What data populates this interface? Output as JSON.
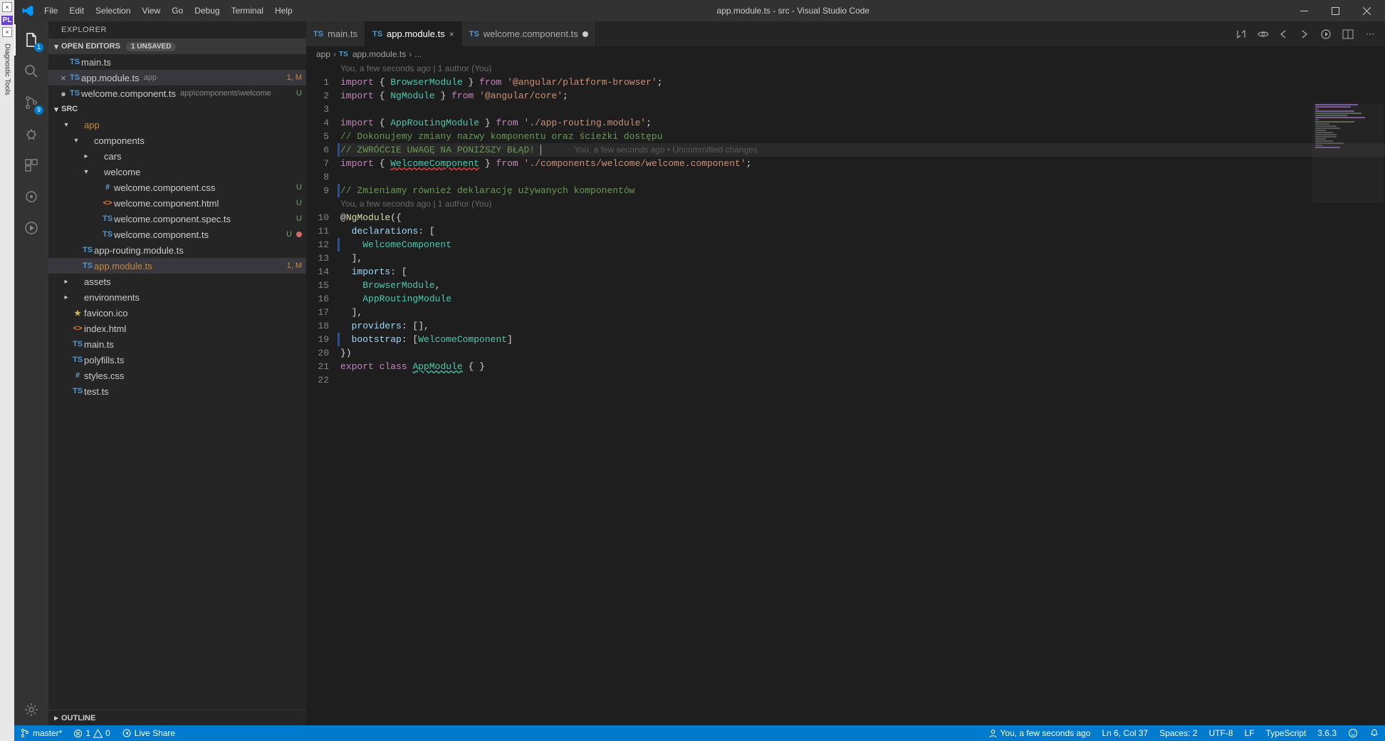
{
  "window_title": "app.module.ts - src - Visual Studio Code",
  "menu": [
    "File",
    "Edit",
    "Selection",
    "View",
    "Go",
    "Debug",
    "Terminal",
    "Help"
  ],
  "activity_badges": {
    "explorer": "1",
    "scm": "9"
  },
  "sidebar": {
    "title": "EXPLORER",
    "open_editors_label": "OPEN EDITORS",
    "unsaved_label": "1 UNSAVED",
    "open_editors": [
      {
        "name": "main.ts",
        "ico": "TS",
        "pre": " "
      },
      {
        "name": "app.module.ts",
        "ico": "TS",
        "pre": "×",
        "hint": "app",
        "status": "1, M",
        "status_cls": "m",
        "active": true
      },
      {
        "name": "welcome.component.ts",
        "ico": "TS",
        "pre": "●",
        "hint": "app\\components\\welcome",
        "status": "U",
        "status_cls": "u"
      }
    ],
    "project_label": "SRC",
    "outline_label": "OUTLINE",
    "tree": [
      {
        "depth": 0,
        "chev": "▾",
        "ico": "",
        "name": "app",
        "color": "#c58b3b"
      },
      {
        "depth": 1,
        "chev": "▾",
        "ico": "",
        "name": "components"
      },
      {
        "depth": 2,
        "chev": "▸",
        "ico": "",
        "name": "cars"
      },
      {
        "depth": 2,
        "chev": "▾",
        "ico": "",
        "name": "welcome"
      },
      {
        "depth": 3,
        "ico": "#",
        "ico_cls": "css-ico",
        "name": "welcome.component.css",
        "status": "U",
        "status_cls": "u"
      },
      {
        "depth": 3,
        "ico": "<>",
        "ico_cls": "html-ico",
        "name": "welcome.component.html",
        "status": "U",
        "status_cls": "u"
      },
      {
        "depth": 3,
        "ico": "TS",
        "ico_cls": "ts-ico",
        "name": "welcome.component.spec.ts",
        "status": "U",
        "status_cls": "u"
      },
      {
        "depth": 3,
        "ico": "TS",
        "ico_cls": "ts-ico",
        "name": "welcome.component.ts",
        "status": "U",
        "status_cls": "u",
        "dot": "err"
      },
      {
        "depth": 1,
        "ico": "TS",
        "ico_cls": "ts-ico",
        "name": "app-routing.module.ts"
      },
      {
        "depth": 1,
        "ico": "TS",
        "ico_cls": "ts-ico",
        "name": "app.module.ts",
        "status": "1, M",
        "status_cls": "m",
        "active": true,
        "color": "#c58b3b"
      },
      {
        "depth": 0,
        "chev": "▸",
        "ico": "",
        "name": "assets"
      },
      {
        "depth": 0,
        "chev": "▸",
        "ico": "",
        "name": "environments"
      },
      {
        "depth": 0,
        "ico": "★",
        "ico_cls": "ico-fav",
        "name": "favicon.ico"
      },
      {
        "depth": 0,
        "ico": "<>",
        "ico_cls": "html-ico",
        "name": "index.html"
      },
      {
        "depth": 0,
        "ico": "TS",
        "ico_cls": "ts-ico",
        "name": "main.ts"
      },
      {
        "depth": 0,
        "ico": "TS",
        "ico_cls": "ts-ico",
        "name": "polyfills.ts"
      },
      {
        "depth": 0,
        "ico": "#",
        "ico_cls": "css-ico",
        "name": "styles.css"
      },
      {
        "depth": 0,
        "ico": "TS",
        "ico_cls": "ts-ico",
        "name": "test.ts"
      }
    ]
  },
  "tabs": [
    {
      "name": "main.ts",
      "ico": "TS"
    },
    {
      "name": "app.module.ts",
      "ico": "TS",
      "active": true,
      "closable": true
    },
    {
      "name": "welcome.component.ts",
      "ico": "TS",
      "dirty": true
    }
  ],
  "breadcrumb": {
    "folder": "app",
    "file": "app.module.ts",
    "more": "..."
  },
  "codelens": "You, a few seconds ago | 1 author (You)",
  "code_lines": [
    {
      "n": 1,
      "html": "<span class='kw'>import</span> <span class='br'>{</span> <span class='cls'>BrowserModule</span> <span class='br'>}</span> <span class='from'>from</span> <span class='str'>'@angular/platform-browser'</span><span class='white'>;</span>"
    },
    {
      "n": 2,
      "html": "<span class='kw'>import</span> <span class='br'>{</span> <span class='cls'>NgModule</span> <span class='br'>}</span> <span class='from'>from</span> <span class='str'>'@angular/core'</span><span class='white'>;</span>"
    },
    {
      "n": 3,
      "html": ""
    },
    {
      "n": 4,
      "html": "<span class='kw'>import</span> <span class='br'>{</span> <span class='cls'>AppRoutingModule</span> <span class='br'>}</span> <span class='from'>from</span> <span class='str'>'./app-routing.module'</span><span class='white'>;</span>"
    },
    {
      "n": 5,
      "html": "<span class='cm'>// Dokonujemy zmiany nazwy komponentu oraz ścieżki dostępu</span>"
    },
    {
      "n": 6,
      "html": "<span class='cm'>// ZWRÓĆCIE UWAGĘ NA PONIŻSZY BŁĄD!</span> <span class='linecursor'></span>      <span class='inline-blame'>You, a few seconds ago • Uncommitted changes</span>",
      "hl": true,
      "bar": true
    },
    {
      "n": 7,
      "html": "<span class='kw'>import</span> <span class='br'>{</span> <span class='cls-err'>WelcomeComponent</span> <span class='br'>}</span> <span class='from'>from</span> <span class='str'>'./components/welcome/welcome.component'</span><span class='white'>;</span>"
    },
    {
      "n": 8,
      "html": ""
    },
    {
      "n": 9,
      "html": "<span class='cm'>// Zmieniamy również deklarację używanych komponentów</span>",
      "bar": true
    },
    {
      "lens": true
    },
    {
      "n": 10,
      "html": "<span class='white'>@</span><span class='at'>NgModule</span><span class='white'>({</span>"
    },
    {
      "n": 11,
      "html": "  <span class='prop'>declarations</span><span class='white'>: [</span>"
    },
    {
      "n": 12,
      "html": "    <span class='cls'>WelcomeComponent</span>",
      "bar": true
    },
    {
      "n": 13,
      "html": "  <span class='white'>],</span>"
    },
    {
      "n": 14,
      "html": "  <span class='prop'>imports</span><span class='white'>: [</span>"
    },
    {
      "n": 15,
      "html": "    <span class='cls'>BrowserModule</span><span class='white'>,</span>"
    },
    {
      "n": 16,
      "html": "    <span class='cls'>AppRoutingModule</span>"
    },
    {
      "n": 17,
      "html": "  <span class='white'>],</span>"
    },
    {
      "n": 18,
      "html": "  <span class='prop'>providers</span><span class='white'>: [],</span>"
    },
    {
      "n": 19,
      "html": "  <span class='prop'>bootstrap</span><span class='white'>: [</span><span class='cls'>WelcomeComponent</span><span class='white'>]</span>",
      "bar": true
    },
    {
      "n": 20,
      "html": "<span class='white'>})</span>"
    },
    {
      "n": 21,
      "html": "<span class='kw'>export</span> <span class='kw'>class</span> <span class='cls-u'>AppModule</span> <span class='white'>{ }</span>"
    },
    {
      "n": 22,
      "html": ""
    }
  ],
  "status": {
    "branch": "master*",
    "errors": "1",
    "warnings": "0",
    "liveshare": "Live Share",
    "blame": "You, a few seconds ago",
    "cursor": "Ln 6, Col 37",
    "spaces": "Spaces: 2",
    "encoding": "UTF-8",
    "eol": "LF",
    "lang": "TypeScript",
    "version": "3.6.3"
  },
  "diag_label": "Diagnostic Tools",
  "pl_label": "PL"
}
